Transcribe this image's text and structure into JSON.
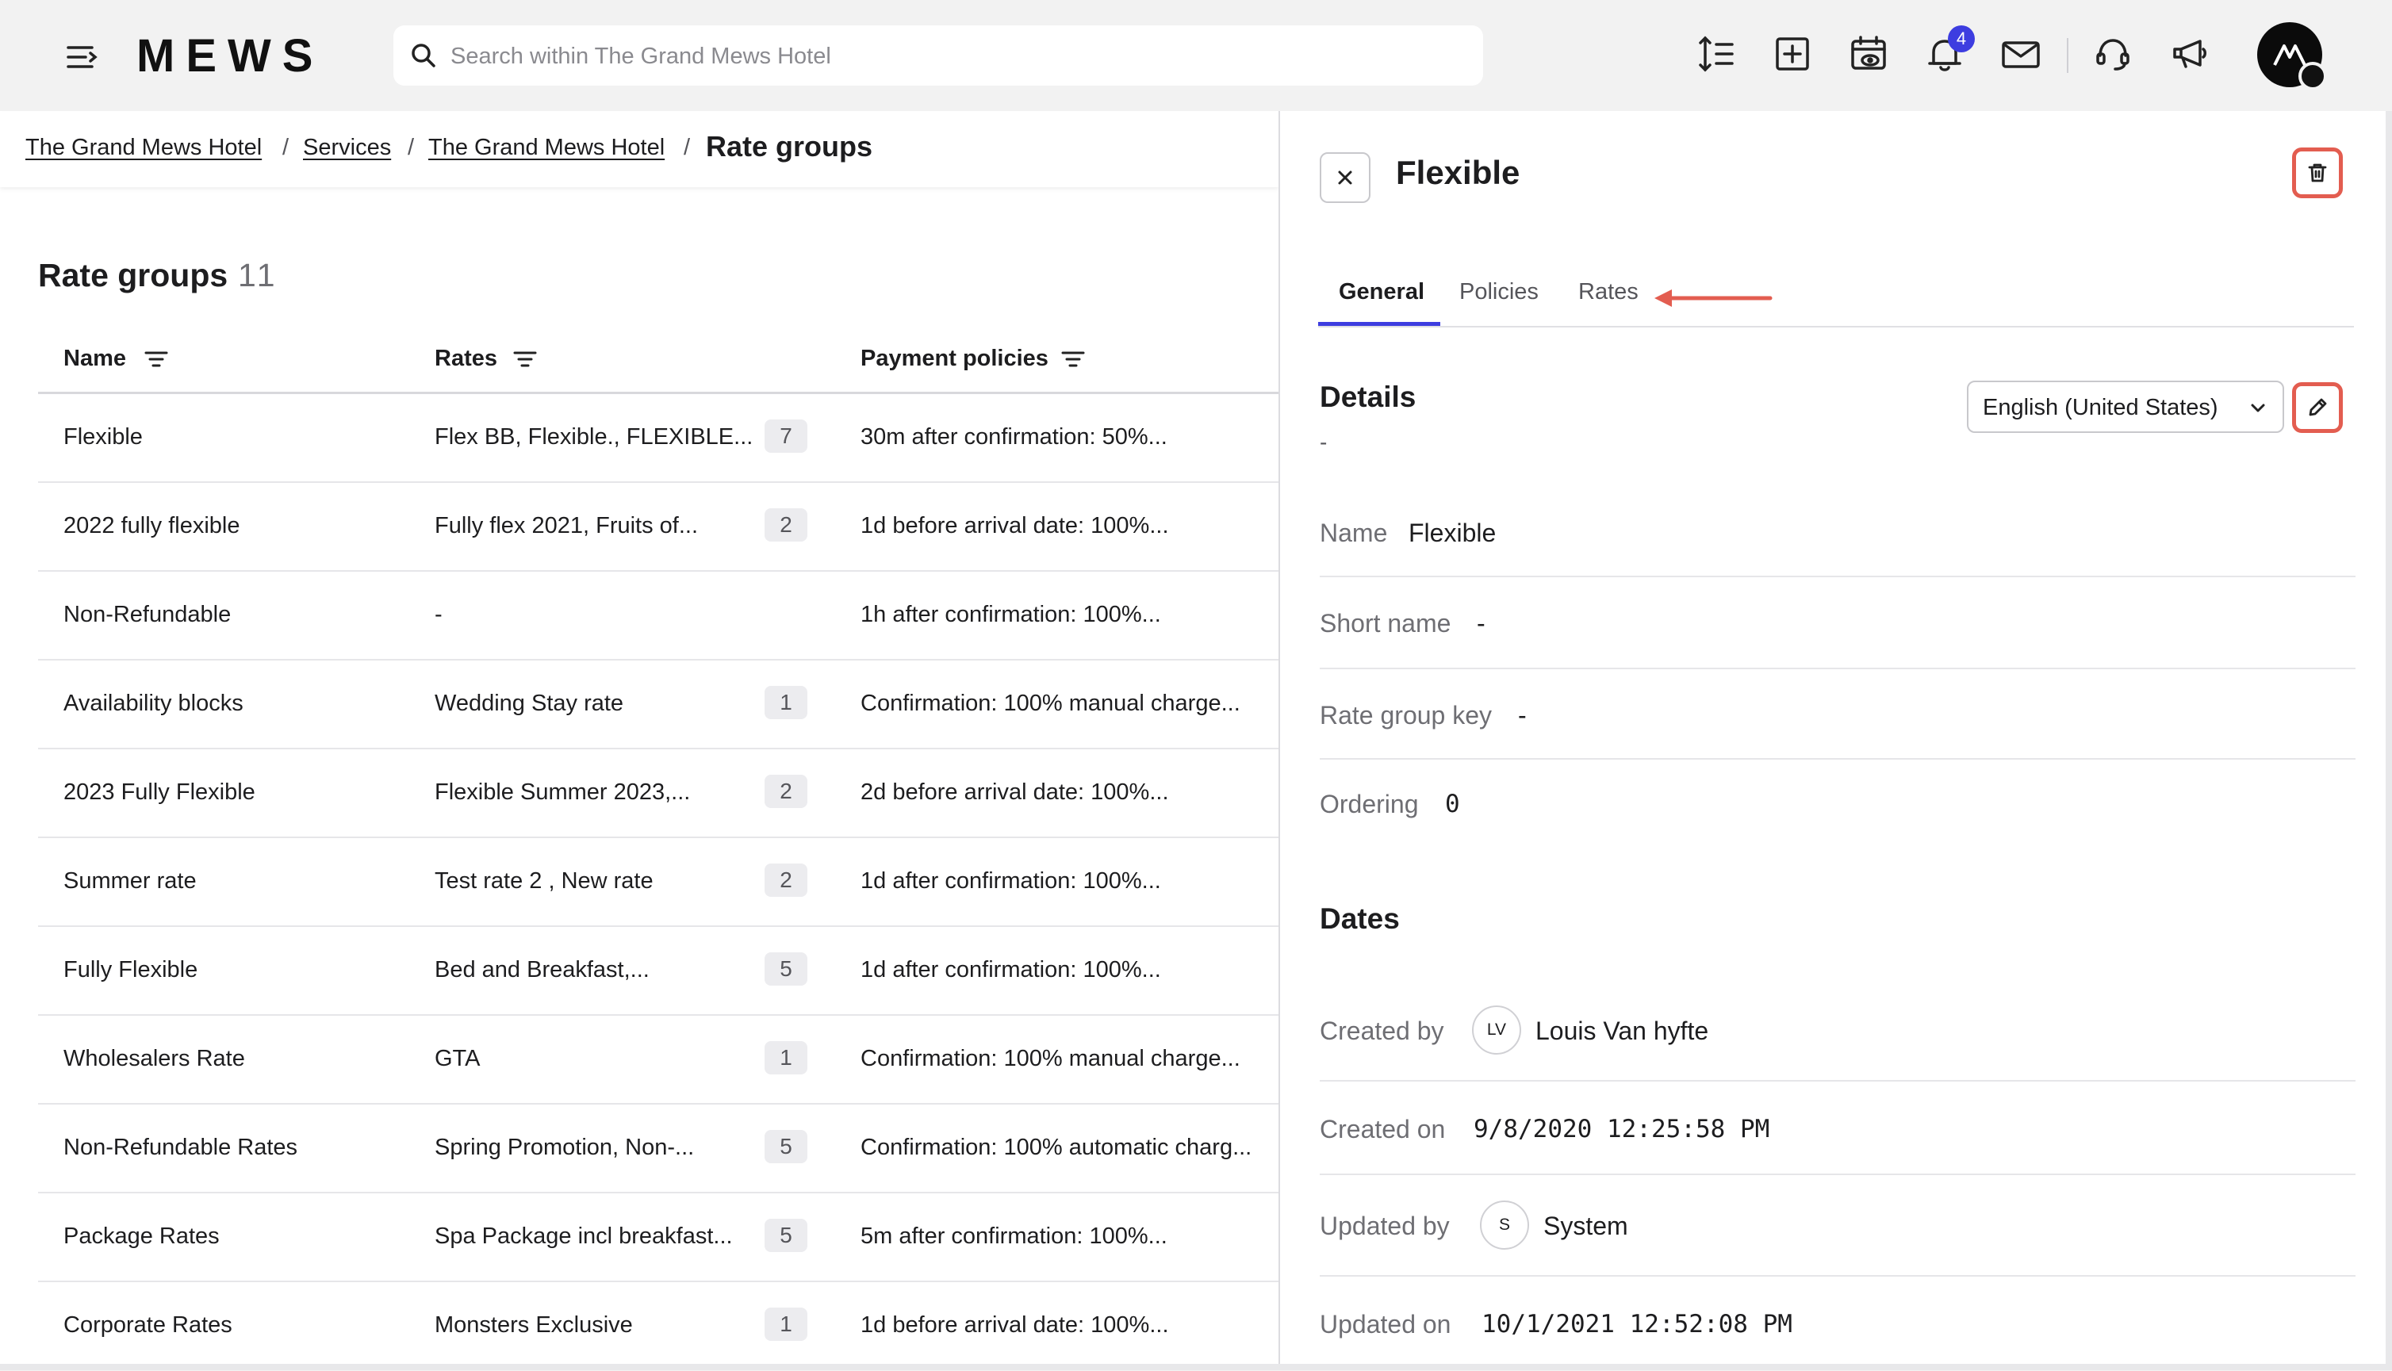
{
  "topbar": {
    "logo_text": "MEWS",
    "search_placeholder": "Search within The Grand Mews Hotel",
    "notification_count": "4",
    "icons": [
      "menu-collapse-icon",
      "search-icon",
      "line-height-icon",
      "add-box-icon",
      "calendar-view-icon",
      "bell-icon",
      "mail-icon",
      "support-icon",
      "megaphone-icon",
      "mews-avatar-icon"
    ],
    "accent_color": "#3d3de0"
  },
  "breadcrumb": {
    "items": [
      "The Grand Mews Hotel",
      "Services",
      "The Grand Mews Hotel"
    ],
    "current": "Rate groups",
    "separator": "/"
  },
  "list": {
    "title": "Rate groups",
    "count": "11",
    "columns": [
      "Name",
      "Rates",
      "Payment policies"
    ],
    "rows": [
      {
        "name": "Flexible",
        "rates": "Flex BB, Flexible., FLEXIBLE...",
        "count": "7",
        "policy": "30m after confirmation: 50%..."
      },
      {
        "name": "2022 fully flexible",
        "rates": "Fully flex 2021, Fruits of...",
        "count": "2",
        "policy": "1d before arrival date: 100%..."
      },
      {
        "name": "Non-Refundable",
        "rates": "-",
        "count": "",
        "policy": "1h after confirmation: 100%..."
      },
      {
        "name": "Availability blocks",
        "rates": "Wedding Stay rate",
        "count": "1",
        "policy": "Confirmation: 100% manual charge..."
      },
      {
        "name": "2023 Fully Flexible",
        "rates": "Flexible Summer 2023,...",
        "count": "2",
        "policy": "2d before arrival date: 100%..."
      },
      {
        "name": "Summer rate",
        "rates": "Test rate 2 , New rate",
        "count": "2",
        "policy": "1d after confirmation: 100%..."
      },
      {
        "name": "Fully Flexible",
        "rates": "Bed and Breakfast,...",
        "count": "5",
        "policy": "1d after confirmation: 100%..."
      },
      {
        "name": "Wholesalers Rate",
        "rates": "GTA",
        "count": "1",
        "policy": "Confirmation: 100% manual charge..."
      },
      {
        "name": "Non-Refundable Rates",
        "rates": "Spring Promotion, Non-...",
        "count": "5",
        "policy": "Confirmation: 100% automatic charg..."
      },
      {
        "name": "Package Rates",
        "rates": "Spa Package incl breakfast...",
        "count": "5",
        "policy": "5m after confirmation: 100%..."
      },
      {
        "name": "Corporate Rates",
        "rates": "Monsters Exclusive",
        "count": "1",
        "policy": "1d before arrival date: 100%..."
      }
    ]
  },
  "detail": {
    "title": "Flexible",
    "tabs": [
      "General",
      "Policies",
      "Rates"
    ],
    "active_tab": "General",
    "highlight_color": "#e35d50",
    "details_heading": "Details",
    "details_description": "-",
    "language": "English (United States)",
    "fields": {
      "name_label": "Name",
      "name_value": "Flexible",
      "short_label": "Short name",
      "short_value": "-",
      "key_label": "Rate group key",
      "key_value": "-",
      "ordering_label": "Ordering",
      "ordering_value": "0"
    },
    "dates_heading": "Dates",
    "dates": {
      "created_by_label": "Created by",
      "created_by_initials": "LV",
      "created_by_name": "Louis Van hyfte",
      "created_on_label": "Created on",
      "created_on_value": "9/8/2020 12:25:58 PM",
      "updated_by_label": "Updated by",
      "updated_by_initials": "S",
      "updated_by_name": "System",
      "updated_on_label": "Updated on",
      "updated_on_value": "10/1/2021 12:52:08 PM"
    }
  }
}
